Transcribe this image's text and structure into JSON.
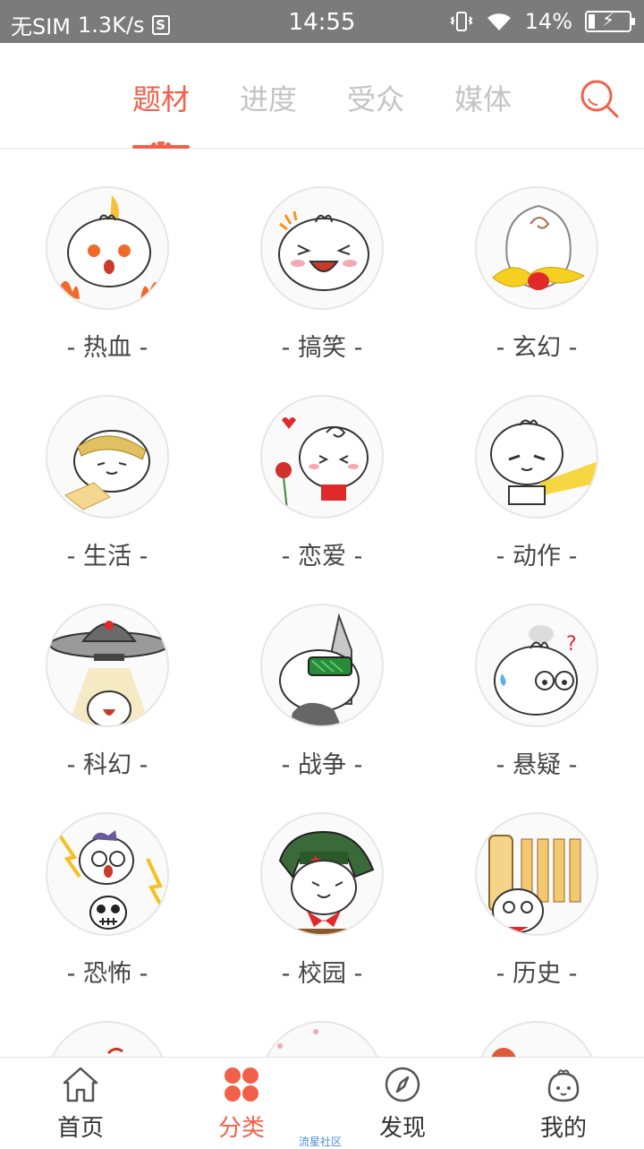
{
  "status_bar": {
    "carrier": "无SIM",
    "speed": "1.3K/s",
    "sim_icon_text": "S",
    "time": "14:55",
    "battery": "14%",
    "battery_level": 0.14
  },
  "tabs": [
    {
      "label": "题材",
      "active": true
    },
    {
      "label": "进度",
      "active": false
    },
    {
      "label": "受众",
      "active": false
    },
    {
      "label": "媒体",
      "active": false
    }
  ],
  "categories": [
    {
      "label": "- 热血 -",
      "icon": "fire-bun-icon"
    },
    {
      "label": "- 搞笑 -",
      "icon": "laughing-bun-icon"
    },
    {
      "label": "- 玄幻 -",
      "icon": "fantasy-bun-icon"
    },
    {
      "label": "- 生活 -",
      "icon": "life-bun-icon"
    },
    {
      "label": "- 恋爱 -",
      "icon": "love-bun-icon"
    },
    {
      "label": "- 动作 -",
      "icon": "action-bun-icon"
    },
    {
      "label": "- 科幻 -",
      "icon": "ufo-bun-icon"
    },
    {
      "label": "- 战争 -",
      "icon": "war-bun-icon"
    },
    {
      "label": "- 悬疑 -",
      "icon": "mystery-bun-icon"
    },
    {
      "label": "- 恐怖 -",
      "icon": "horror-bun-icon"
    },
    {
      "label": "- 校园 -",
      "icon": "campus-bun-icon"
    },
    {
      "label": "- 历史 -",
      "icon": "history-bun-icon"
    }
  ],
  "bottom_nav": [
    {
      "label": "首页",
      "icon": "home-icon",
      "active": false
    },
    {
      "label": "分类",
      "icon": "category-icon",
      "active": true
    },
    {
      "label": "发现",
      "icon": "compass-icon",
      "active": false
    },
    {
      "label": "我的",
      "icon": "profile-icon",
      "active": false
    }
  ],
  "watermark": "流星社区",
  "colors": {
    "accent": "#f3604a",
    "tab_inactive": "#c4c4c4",
    "status_bar": "#7b7b7b",
    "label_text": "#444444"
  }
}
